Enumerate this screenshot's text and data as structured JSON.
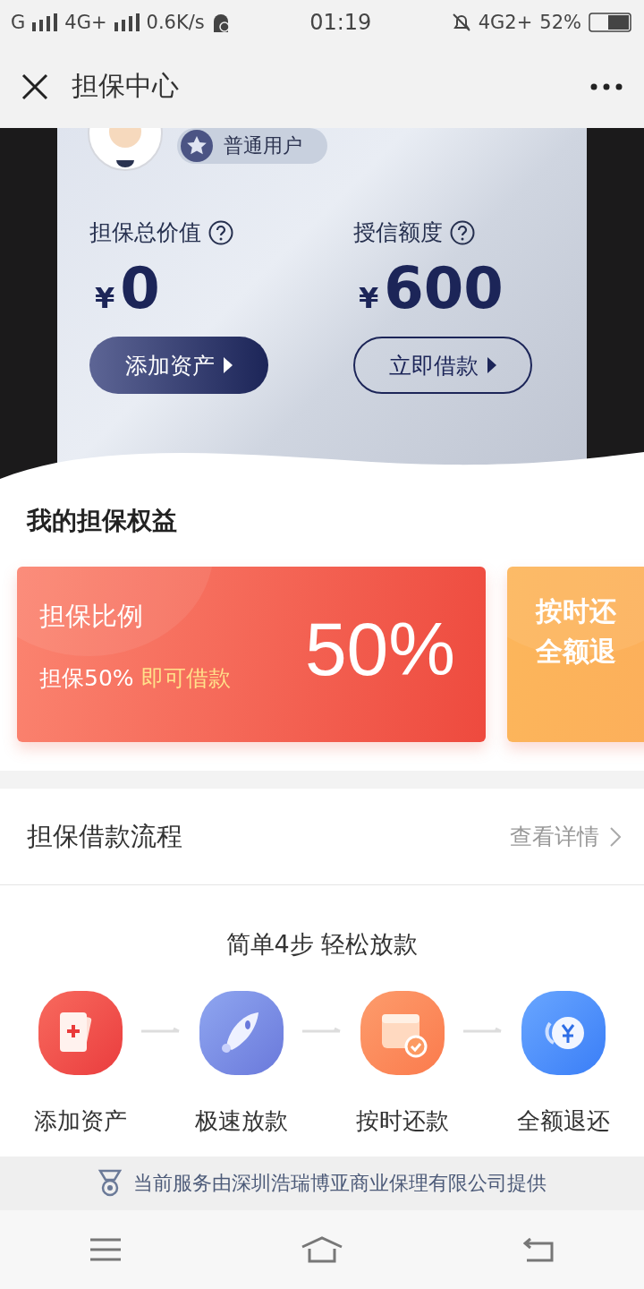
{
  "status_bar": {
    "carrier": "G",
    "network": "4G+",
    "speed": "0.6K/s",
    "time": "01:19",
    "network_2": "4G2+",
    "battery": "52%"
  },
  "nav": {
    "title": "担保中心"
  },
  "hero": {
    "badge": "普通用户",
    "metrics": [
      {
        "label": "担保总价值",
        "currency": "¥",
        "amount": "0",
        "button": "添加资产",
        "kind": "filled"
      },
      {
        "label": "授信额度",
        "currency": "¥",
        "amount": "600",
        "button": "立即借款",
        "kind": "outline"
      }
    ]
  },
  "benefits": {
    "title": "我的担保权益",
    "cards": [
      {
        "kind": "ratio",
        "title": "担保比例",
        "note": "担保50%",
        "highlight": "即可借款",
        "value": "50%"
      },
      {
        "kind": "lines",
        "lines": [
          "按时还",
          "全额退"
        ]
      }
    ]
  },
  "process": {
    "title": "担保借款流程",
    "link": "查看详情",
    "subtitle": "简单4步 轻松放款",
    "steps": [
      {
        "label": "添加资产",
        "kind": "cards"
      },
      {
        "label": "极速放款",
        "kind": "rocket"
      },
      {
        "label": "按时还款",
        "kind": "calendar"
      },
      {
        "label": "全额退还",
        "kind": "refund"
      }
    ]
  },
  "footer": {
    "text": "当前服务由深圳浩瑞博亚商业保理有限公司提供"
  }
}
